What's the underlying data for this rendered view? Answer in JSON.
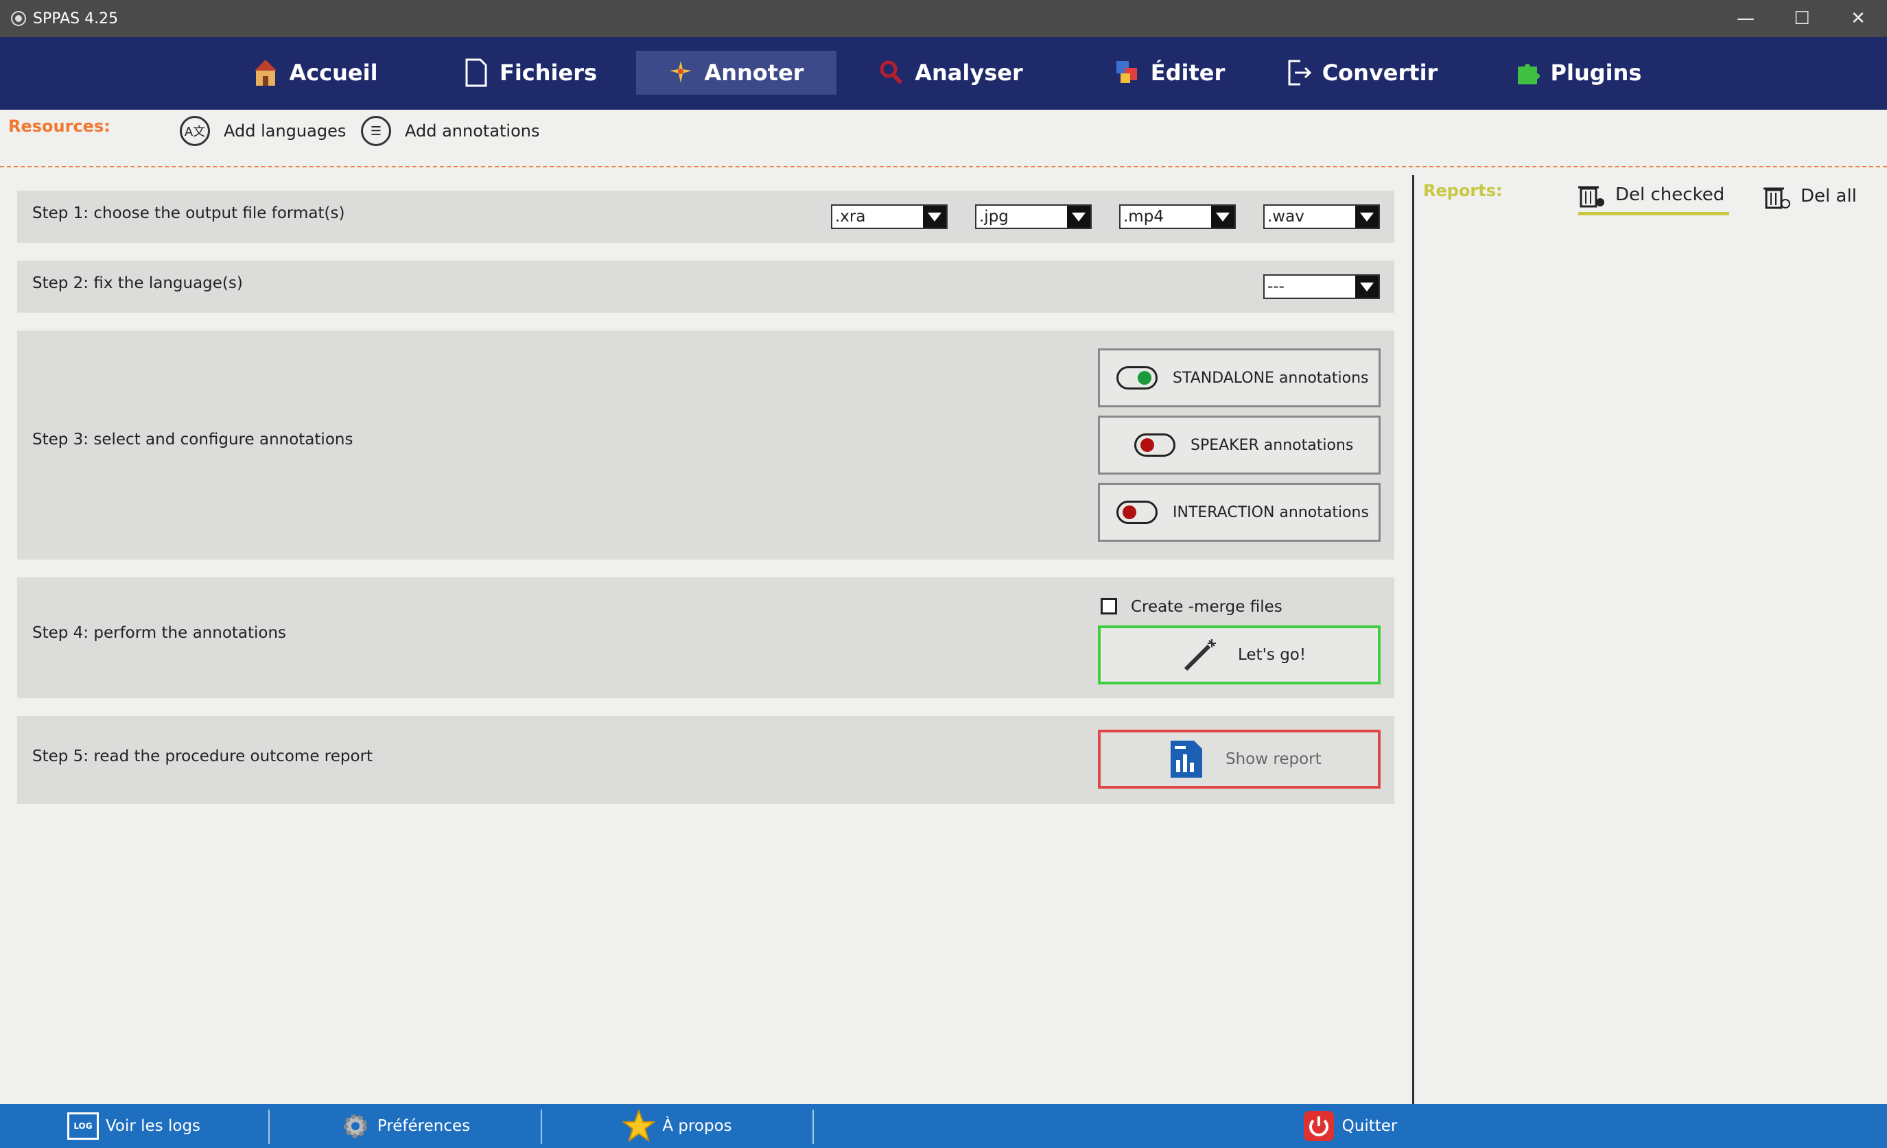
{
  "window": {
    "title": "SPPAS 4.25",
    "minimize_glyph": "—",
    "maximize_glyph": "☐",
    "close_glyph": "✕"
  },
  "nav": {
    "items": [
      {
        "label": "Accueil",
        "icon": "home-icon"
      },
      {
        "label": "Fichiers",
        "icon": "file-icon"
      },
      {
        "label": "Annoter",
        "icon": "sparkle-icon",
        "active": true
      },
      {
        "label": "Analyser",
        "icon": "magnifier-icon"
      },
      {
        "label": "Éditer",
        "icon": "edit-icon"
      },
      {
        "label": "Convertir",
        "icon": "export-icon"
      },
      {
        "label": "Plugins",
        "icon": "puzzle-icon"
      }
    ]
  },
  "resources": {
    "label": "Resources:",
    "add_languages": "Add languages",
    "add_annotations": "Add annotations"
  },
  "steps": {
    "step1": {
      "label": "Step 1: choose the output file format(s)",
      "formats": [
        ".xra",
        ".jpg",
        ".mp4",
        ".wav"
      ]
    },
    "step2": {
      "label": "Step 2: fix the language(s)",
      "language": "---"
    },
    "step3": {
      "label": "Step 3: select and configure annotations",
      "buttons": [
        {
          "label": "STANDALONE annotations",
          "state": "on"
        },
        {
          "label": "SPEAKER annotations",
          "state": "off"
        },
        {
          "label": "INTERACTION annotations",
          "state": "off"
        }
      ]
    },
    "step4": {
      "label": "Step 4: perform the annotations",
      "merge_label": "Create -merge files",
      "merge_checked": false,
      "go_label": "Let's go!"
    },
    "step5": {
      "label": "Step 5: read the procedure outcome report",
      "report_label": "Show report"
    }
  },
  "reports": {
    "label": "Reports:",
    "del_checked": "Del checked",
    "del_all": "Del all"
  },
  "bottom": {
    "logs": "Voir les logs",
    "logs_badge": "LOG",
    "preferences": "Préférences",
    "about": "À propos",
    "quit": "Quitter"
  },
  "colors": {
    "nav_bg": "#1f2a6b",
    "accent_orange": "#f07830",
    "reports_yellow": "#c8c840",
    "go_green": "#3ecf3e",
    "report_red": "#e04848",
    "bottom_blue": "#1e6fc0"
  }
}
